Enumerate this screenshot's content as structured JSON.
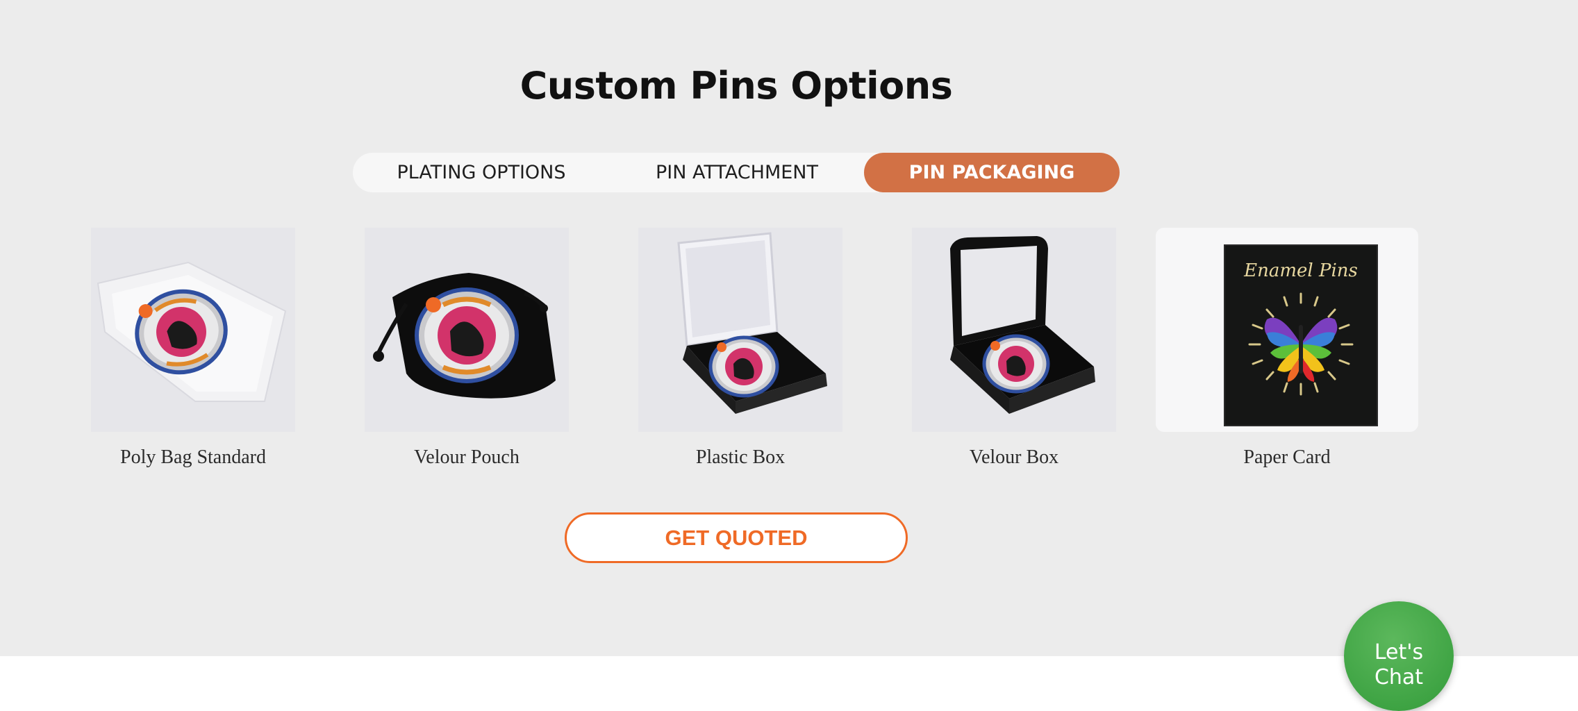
{
  "title": "Custom Pins Options",
  "tabs": [
    {
      "label": "PLATING OPTIONS",
      "active": false
    },
    {
      "label": "PIN ATTACHMENT",
      "active": false
    },
    {
      "label": "PIN PACKAGING",
      "active": true
    }
  ],
  "products": [
    {
      "name": "Poly Bag Standard",
      "image": "poly-bag-image"
    },
    {
      "name": "Velour Pouch",
      "image": "velour-pouch-image"
    },
    {
      "name": "Plastic Box",
      "image": "plastic-box-image"
    },
    {
      "name": "Velour Box",
      "image": "velour-box-image"
    },
    {
      "name": "Paper Card",
      "image": "paper-card-image",
      "card_text": "Enamel Pins"
    }
  ],
  "cta": {
    "label": "GET QUOTED"
  },
  "chat": {
    "label": "Let's\nChat"
  },
  "colors": {
    "section_bg": "#ececec",
    "active_tab": "#d27145",
    "cta_accent": "#ef6a26",
    "chat_green": "#3fa444"
  }
}
